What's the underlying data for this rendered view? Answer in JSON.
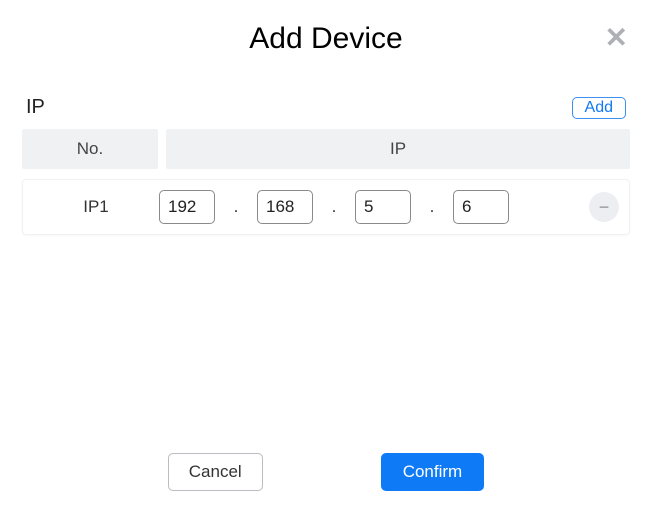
{
  "modal": {
    "title": "Add Device",
    "section_label": "IP",
    "add_button": "Add",
    "columns": {
      "no": "No.",
      "ip": "IP"
    },
    "rows": [
      {
        "label": "IP1",
        "octets": [
          "192",
          "168",
          "5",
          "6"
        ]
      }
    ],
    "buttons": {
      "cancel": "Cancel",
      "confirm": "Confirm"
    }
  }
}
